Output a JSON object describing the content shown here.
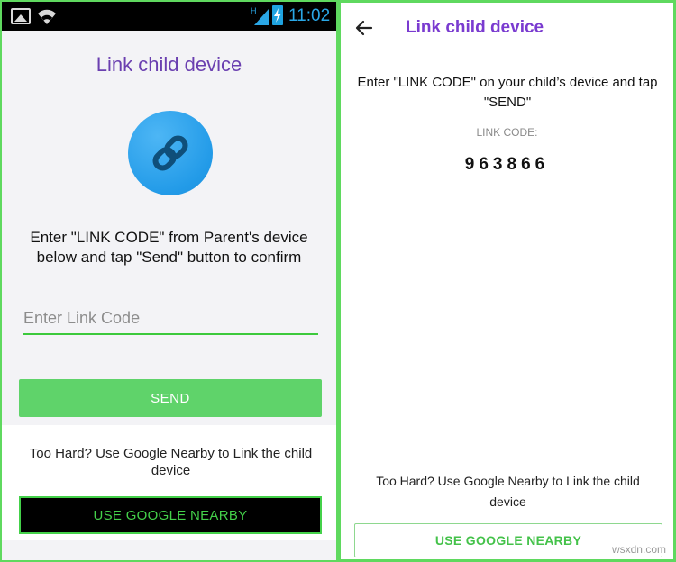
{
  "left": {
    "status_bar": {
      "time": "11:02",
      "icons": [
        "image-icon",
        "wifi-icon",
        "signal-icon",
        "battery-charging-icon"
      ]
    },
    "title": "Link child device",
    "link_icon": "link-icon",
    "instructions": "Enter \"LINK CODE\" from Parent's device below and tap \"Send\" button to confirm",
    "input": {
      "placeholder": "Enter Link Code",
      "value": ""
    },
    "send_label": "SEND",
    "too_hard": "Too Hard? Use Google Nearby to Link the child device",
    "nearby_label": "USE GOOGLE NEARBY",
    "colors": {
      "accent": "#5fd36a",
      "title": "#6a3fb0",
      "badge": "#239be8"
    }
  },
  "right": {
    "back_icon": "arrow-left-icon",
    "title": "Link child device",
    "instructions": "Enter \"LINK CODE\" on your child’s device and tap \"SEND\"",
    "code_label": "LINK CODE:",
    "code": "963866",
    "too_hard": "Too Hard? Use Google Nearby to Link the child device",
    "nearby_label": "USE GOOGLE NEARBY",
    "colors": {
      "title": "#7a3bd0",
      "accent": "#44c24a"
    }
  },
  "watermark": "wsxdn.com"
}
